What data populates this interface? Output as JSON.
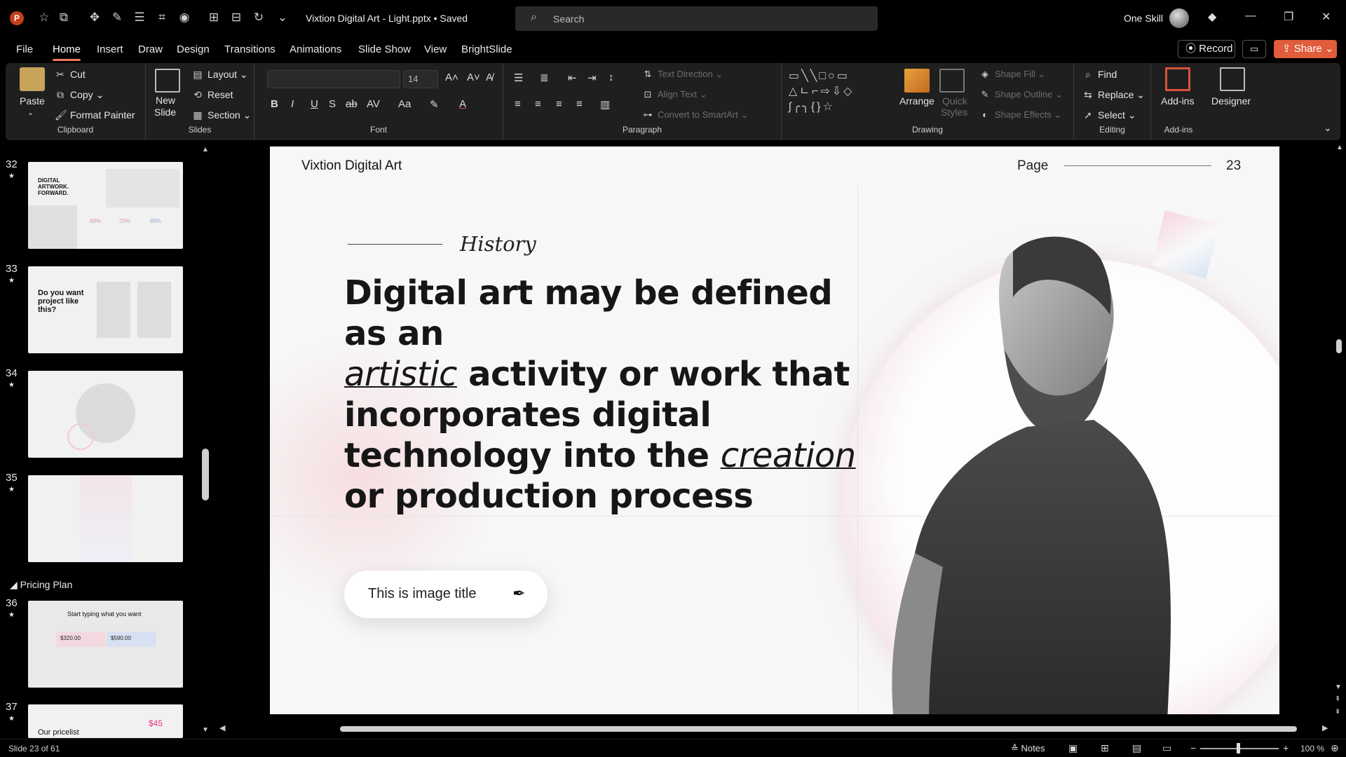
{
  "titlebar": {
    "doc_title": "Vixtion Digital Art - Light.pptx • Saved",
    "search_placeholder": "Search",
    "user_name": "One Skill"
  },
  "menu": {
    "tabs": [
      "File",
      "Home",
      "Insert",
      "Draw",
      "Design",
      "Transitions",
      "Animations",
      "Slide Show",
      "View",
      "BrightSlide"
    ],
    "active": "Home",
    "record": "Record",
    "share": "Share"
  },
  "ribbon": {
    "clipboard": {
      "label": "Clipboard",
      "paste": "Paste",
      "cut": "Cut",
      "copy": "Copy",
      "format_painter": "Format Painter"
    },
    "slides": {
      "label": "Slides",
      "new_slide_1": "New",
      "new_slide_2": "Slide",
      "layout": "Layout",
      "reset": "Reset",
      "section": "Section"
    },
    "font": {
      "label": "Font",
      "size": "14"
    },
    "paragraph": {
      "label": "Paragraph",
      "text_direction": "Text Direction",
      "align_text": "Align Text",
      "convert_smartart": "Convert to SmartArt"
    },
    "drawing": {
      "label": "Drawing",
      "arrange": "Arrange",
      "quick_styles_1": "Quick",
      "quick_styles_2": "Styles",
      "shape_fill": "Shape Fill",
      "shape_outline": "Shape Outline",
      "shape_effects": "Shape Effects"
    },
    "editing": {
      "label": "Editing",
      "find": "Find",
      "replace": "Replace",
      "select": "Select"
    },
    "addins": {
      "label": "Add-ins",
      "addins": "Add-ins",
      "designer": "Designer"
    }
  },
  "thumbnails": {
    "items": [
      {
        "num": "32",
        "title": "DIGITAL ARTWORK. FORWARD."
      },
      {
        "num": "33",
        "title": "Do you want project like this?"
      },
      {
        "num": "34",
        "title": ""
      },
      {
        "num": "35",
        "title": ""
      },
      {
        "num": "36",
        "title": "Start typing what you want"
      },
      {
        "num": "37",
        "title": "Our pricelist"
      }
    ],
    "section": "Pricing Plan",
    "prices": {
      "a": "$320.00",
      "b": "$590.00",
      "c": "$45"
    },
    "thumb_pct": {
      "a": "68%",
      "b": "20%",
      "c": "89%"
    }
  },
  "slide": {
    "brand": "Vixtion Digital Art",
    "page_label": "Page",
    "page_number": "23",
    "kicker": "History",
    "headline_1": "Digital art may be defined as an",
    "headline_em1": "artistic",
    "headline_2": " activity or work that incorporates digital technology into the ",
    "headline_em2": "creation",
    "headline_3": " or production process",
    "image_title": "This is image title"
  },
  "status": {
    "slide_count": "Slide 23 of 61",
    "notes": "Notes",
    "zoom": "100 %"
  },
  "colors": {
    "accent": "#e05c3a",
    "tab_underline": "#f07a5d",
    "ribbon_bg": "#1f1f1f"
  }
}
